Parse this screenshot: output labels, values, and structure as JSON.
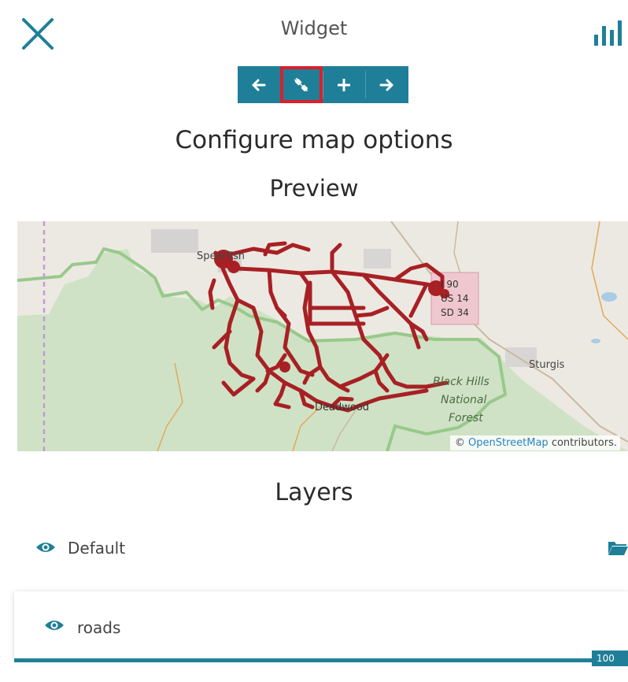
{
  "header": {
    "title": "Widget",
    "close_icon": "close-icon",
    "chart_icon": "bar-chart-icon"
  },
  "toolbar": {
    "buttons": [
      {
        "icon": "arrow-left-icon",
        "selected": false
      },
      {
        "icon": "plug-icon",
        "selected": true
      },
      {
        "icon": "plus-icon",
        "selected": false
      },
      {
        "icon": "arrow-right-icon",
        "selected": false
      }
    ],
    "color": "#1f7f98",
    "selected_outline_color": "#d8202c"
  },
  "headings": {
    "configure": "Configure map options",
    "preview": "Preview"
  },
  "map": {
    "labels": {
      "town_north": "Spearfish",
      "town_center": "Deadwood",
      "town_east": "Sturgis",
      "shield_line1": "I 90",
      "shield_line2": "US 14",
      "shield_line3": "SD 34",
      "forest_line1": "Black Hills",
      "forest_line2": "National",
      "forest_line3": "Forest"
    },
    "attribution": {
      "prefix": "©",
      "link": "OpenStreetMap",
      "suffix": "contributors."
    },
    "road_color": "#a82024",
    "forest_color": "#cfe2c5"
  },
  "layers": {
    "title": "Layers",
    "items": [
      {
        "name": "Default",
        "visible": true
      },
      {
        "name": "roads",
        "visible": true
      }
    ],
    "folder_icon": "folder-open-icon"
  },
  "progress": {
    "percent": 100,
    "label": "100 %"
  }
}
